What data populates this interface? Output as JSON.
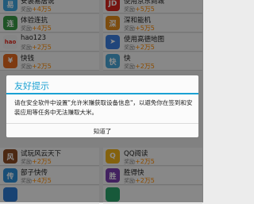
{
  "apps": [
    {
      "name": "安装易居说",
      "reward_prefix": "奖励",
      "reward": "+4万5",
      "icon": "house-icon",
      "icon_text": "易",
      "color": "#3fa7e0"
    },
    {
      "name": "使用京东商城",
      "reward_prefix": "奖励",
      "reward": "+5万5",
      "icon": "jd-icon",
      "icon_text": "JD",
      "color": "#d7261e"
    },
    {
      "name": "体验连抗",
      "reward_prefix": "奖励",
      "reward": "+4万5",
      "icon": "game-icon",
      "icon_text": "连",
      "color": "#3a9a46"
    },
    {
      "name": "深和能机",
      "reward_prefix": "奖励",
      "reward": "+5万5",
      "icon": "game2-icon",
      "icon_text": "深",
      "color": "#e28a1c"
    },
    {
      "name": "hao123",
      "reward_prefix": "奖励",
      "reward": "+2万5",
      "icon": "hao123-icon",
      "icon_text": "hao",
      "color": "#f2f2f2"
    },
    {
      "name": "使用高德地图",
      "reward_prefix": "奖励",
      "reward": "+2万5",
      "icon": "map-icon",
      "icon_text": "➤",
      "color": "#3b7fe0"
    },
    {
      "name": "快钱",
      "reward_prefix": "奖励",
      "reward": "+2万5",
      "icon": "money-icon",
      "icon_text": "¥",
      "color": "#e56b1f"
    },
    {
      "name": "快",
      "reward_prefix": "奖励",
      "reward": "+2万5",
      "icon": "app-icon",
      "icon_text": "快",
      "color": "#4aa7d8"
    },
    {
      "name": "试玩风云天下",
      "reward_prefix": "奖励",
      "reward": "+2万5",
      "icon": "warrior-icon",
      "icon_text": "风",
      "color": "#8a4b24"
    },
    {
      "name": "QQ阅读",
      "reward_prefix": "奖励",
      "reward": "+2万5",
      "icon": "qq-reader-icon",
      "icon_text": "Q",
      "color": "#f0b21a"
    },
    {
      "name": "部子快传",
      "reward_prefix": "奖励",
      "reward": "+4万5",
      "icon": "transfer-icon",
      "icon_text": "传",
      "color": "#2f8fd8"
    },
    {
      "name": "胜得快",
      "reward_prefix": "奖励",
      "reward": "+2万5",
      "icon": "speed-icon",
      "icon_text": "胜",
      "color": "#7a3fb0"
    },
    {
      "name": "",
      "reward_prefix": "",
      "reward": "",
      "icon": "app-icon",
      "icon_text": "",
      "color": "#2e7bd1"
    },
    {
      "name": "",
      "reward_prefix": "",
      "reward": "",
      "icon": "app-icon",
      "icon_text": "",
      "color": "#2aa36a"
    }
  ],
  "dialog": {
    "title": "友好提示",
    "message": "请在安全软件中设置\"允许米赚获取设备信息\"，以避免你在签到和安装应用等任务中无法赚取大米。",
    "button": "知道了"
  },
  "colors": {
    "accent": "#1ba1d3",
    "reward": "#ff8a00"
  }
}
